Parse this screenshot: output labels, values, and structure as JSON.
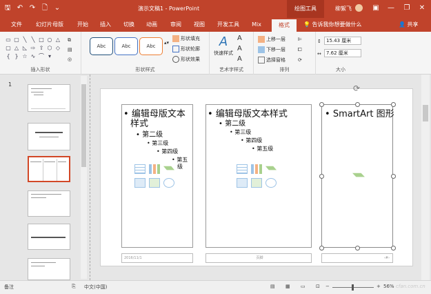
{
  "title_bar": {
    "doc_title": "演示文稿1 - PowerPoint",
    "contextual_tools": "绘图工具",
    "user_name": "柳絮飞",
    "minimize": "—",
    "restore": "❐",
    "close": "✕",
    "ribbon_toggle": "▣"
  },
  "qat": {
    "save_icon": "🖫",
    "undo_icon": "↶",
    "redo_icon": "↷",
    "new_icon": "🗋",
    "customize_icon": "⌄"
  },
  "tabs": [
    "文件",
    "幻灯片母版",
    "开始",
    "插入",
    "切换",
    "动画",
    "审阅",
    "视图",
    "开发工具",
    "Mix",
    "格式"
  ],
  "active_tab": "格式",
  "tell_me": "告诉我你想要做什么",
  "share": "共享",
  "ribbon": {
    "groups": {
      "insert_shapes": "插入形状",
      "shape_styles": "形状样式",
      "wordart_styles": "艺术字样式",
      "arrange": "排列",
      "size": "大小"
    },
    "style_samples": [
      "Abc",
      "Abc",
      "Abc"
    ],
    "shape_fill": "形状填充",
    "shape_outline": "形状轮廓",
    "shape_effects": "形状效果",
    "quick_styles": "快速样式",
    "bring_forward": "上移一层",
    "send_backward": "下移一层",
    "selection_pane": "选择窗格",
    "height": "15.43 厘米",
    "width": "7.62 厘米"
  },
  "thumbnails": {
    "slide_number": "1"
  },
  "slide": {
    "col1": {
      "level1": "编辑母版文本",
      "level1b": "样式",
      "level2": "第二级",
      "level3": "第三级",
      "level4": "第四级",
      "level5a": "第五",
      "level5b": "级"
    },
    "col2": {
      "level1": "编辑母版文本样式",
      "level2": "第二级",
      "level3": "第三级",
      "level4": "第四级",
      "level5": "第五级"
    },
    "col3": {
      "level1": "SmartArt 图形"
    },
    "footer_date": "2016/11/1",
    "footer_text": "页脚",
    "footer_num": "‹#›"
  },
  "status": {
    "notes": "备注",
    "language": "中文(中国)",
    "zoom": "56%",
    "watermark": "cfan.com.cn"
  }
}
